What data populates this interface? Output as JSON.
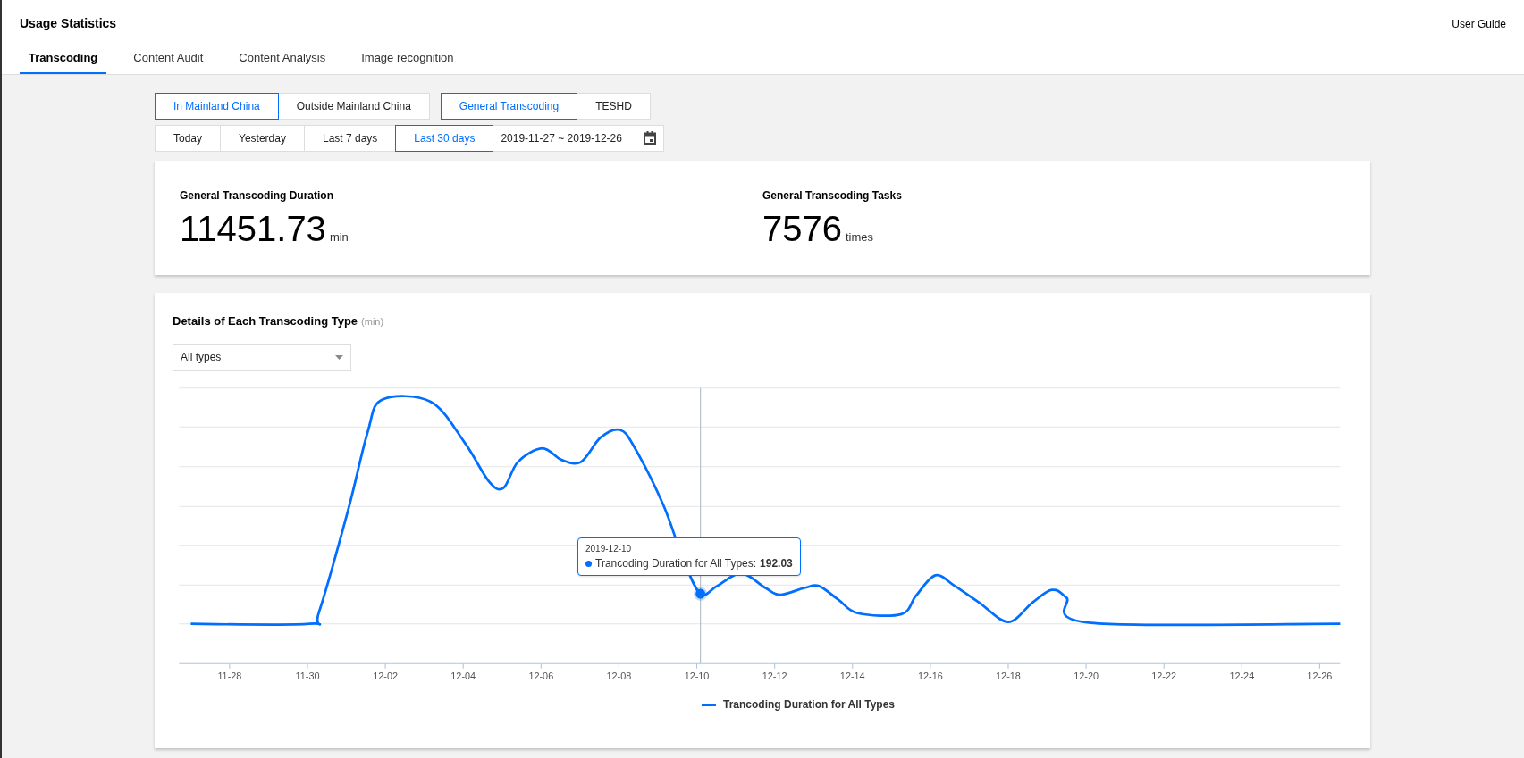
{
  "header": {
    "title": "Usage Statistics",
    "link": "User Guide"
  },
  "tabs": [
    {
      "label": "Transcoding",
      "selected": true
    },
    {
      "label": "Content Audit",
      "selected": false
    },
    {
      "label": "Content Analysis",
      "selected": false
    },
    {
      "label": "Image recognition",
      "selected": false
    }
  ],
  "region_toggle": [
    {
      "label": "In Mainland China",
      "selected": true
    },
    {
      "label": "Outside Mainland China",
      "selected": false
    }
  ],
  "type_toggle": [
    {
      "label": "General Transcoding",
      "selected": true
    },
    {
      "label": "TESHD",
      "selected": false
    }
  ],
  "date_range": [
    {
      "label": "Today",
      "selected": false
    },
    {
      "label": "Yesterday",
      "selected": false
    },
    {
      "label": "Last 7 days",
      "selected": false
    },
    {
      "label": "Last 30 days",
      "selected": true
    }
  ],
  "date_field": {
    "value": "2019-11-27 ~ 2019-12-26"
  },
  "stats": [
    {
      "title": "General Transcoding Duration",
      "value": "11451.73",
      "unit": "min"
    },
    {
      "title": "General Transcoding Tasks",
      "value": "7576",
      "unit": "times"
    }
  ],
  "details": {
    "title": "Details of Each Transcoding Type",
    "unit": "(min)",
    "type_select": {
      "value": "All types"
    },
    "x_ticks": [
      "11-28",
      "11-30",
      "12-02",
      "12-04",
      "12-06",
      "12-08",
      "12-10",
      "12-12",
      "12-14",
      "12-16",
      "12-18",
      "12-20",
      "12-22",
      "12-24",
      "12-26"
    ],
    "tooltip": {
      "date": "2019-12-10",
      "label": "Trancoding Duration for All Types:",
      "value": "192.03"
    },
    "legend": "Trancoding Duration for All Types"
  }
}
